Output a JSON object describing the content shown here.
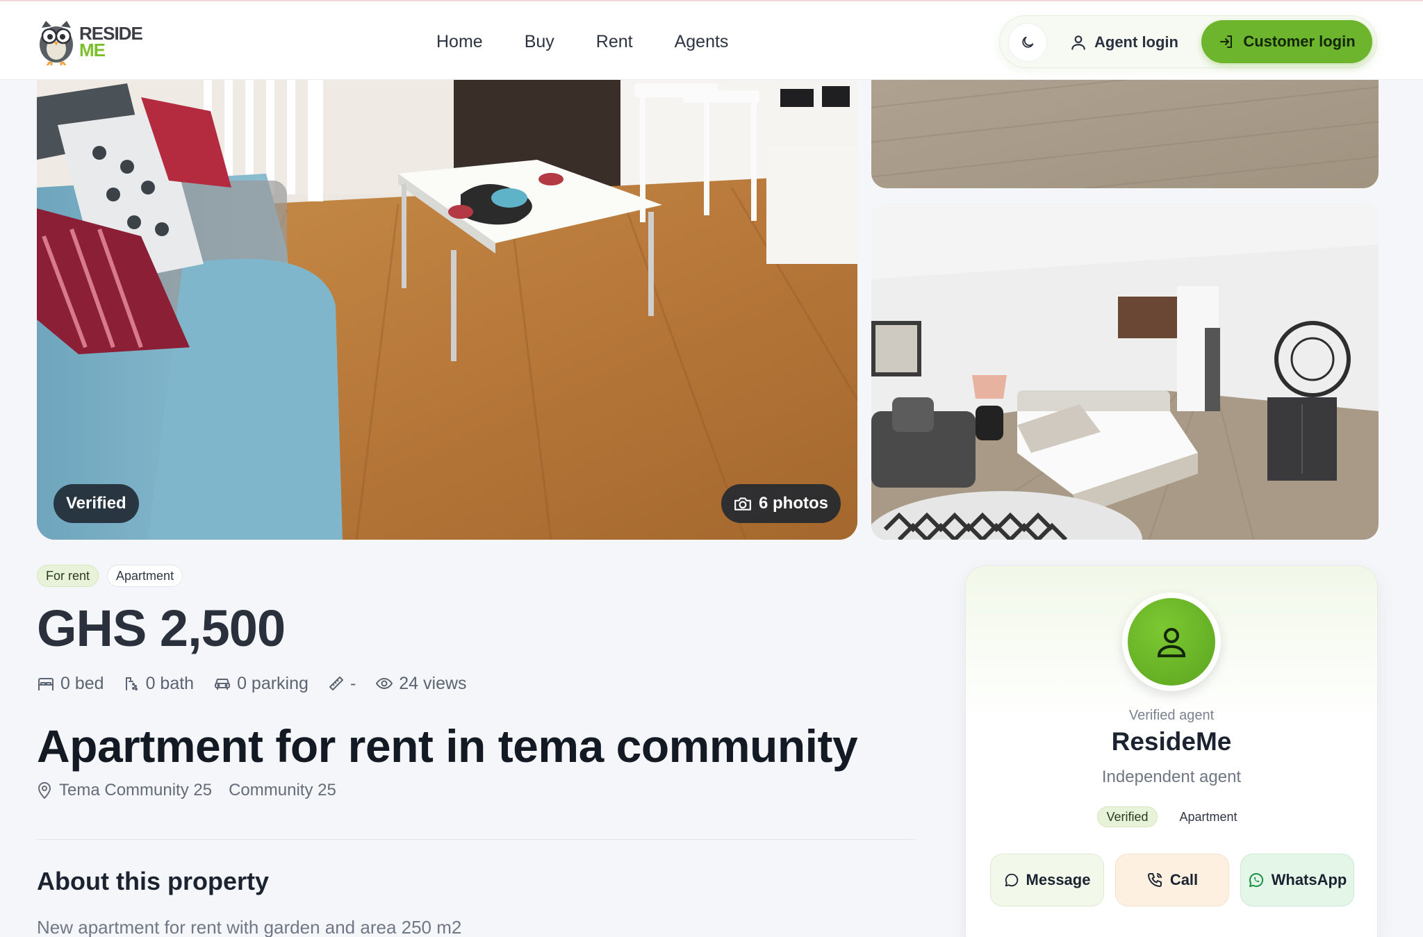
{
  "header": {
    "logo_line1": "RESIDE",
    "logo_line2": "ME",
    "nav": [
      "Home",
      "Buy",
      "Rent",
      "Agents"
    ],
    "agent_login": "Agent login",
    "customer_login": "Customer login"
  },
  "gallery": {
    "verified_badge": "Verified",
    "photos_count": "6 photos"
  },
  "listing": {
    "tags": [
      "For rent",
      "Apartment"
    ],
    "price": "GHS 2,500",
    "stats": {
      "bed": "0 bed",
      "bath": "0 bath",
      "parking": "0 parking",
      "area": "-",
      "views": "24 views"
    },
    "title": "Apartment for rent in tema community",
    "location_primary": "Tema Community 25",
    "location_secondary": "Community 25",
    "about_title": "About this property",
    "about_text": "New apartment for rent with garden and area 250 m2"
  },
  "agent": {
    "label": "Verified agent",
    "name": "ResideMe",
    "role": "Independent agent",
    "tags": [
      "Verified",
      "Apartment"
    ],
    "actions": {
      "message": "Message",
      "call": "Call",
      "whatsapp": "WhatsApp"
    }
  },
  "colors": {
    "accent": "#6db52c",
    "page_background": "#f5f6f9",
    "text_dark": "#141a24"
  },
  "icons": [
    "owl-logo-icon",
    "moon-icon",
    "user-icon",
    "login-icon",
    "camera-icon",
    "bed-icon",
    "bath-icon",
    "car-icon",
    "ruler-icon",
    "eye-icon",
    "map-pin-icon",
    "chat-icon",
    "phone-icon",
    "whatsapp-icon"
  ]
}
